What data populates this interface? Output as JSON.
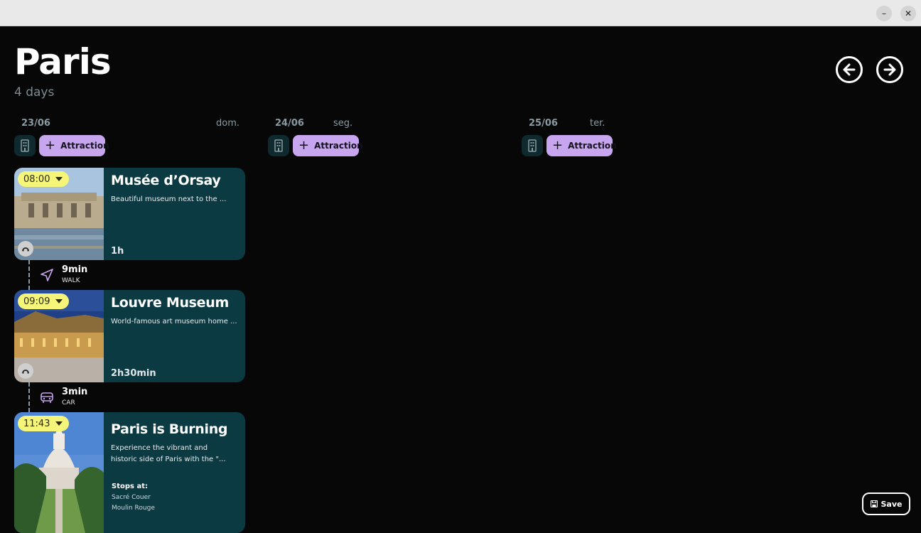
{
  "window": {
    "minimize_icon": "minimize-icon",
    "close_icon": "close-icon",
    "minimize_glyph": "–",
    "close_glyph": "✕"
  },
  "trip": {
    "city": "Paris",
    "duration": "4 days"
  },
  "nav": {
    "prev_icon": "arrow-left-circle-icon",
    "next_icon": "arrow-right-circle-icon"
  },
  "days": [
    {
      "date": "23/06",
      "weekday": "dom.",
      "attraction_label": "Attraction"
    },
    {
      "date": "24/06",
      "weekday": "seg.",
      "attraction_label": "Attraction"
    },
    {
      "date": "25/06",
      "weekday": "ter.",
      "attraction_label": "Attraction"
    }
  ],
  "activities": [
    {
      "time": "08:00",
      "title": "Musée d’Orsay",
      "description": "Beautiful museum next to the ...",
      "duration": "1h"
    },
    {
      "time": "09:09",
      "title": "Louvre Museum",
      "description": "World-famous art museum home ...",
      "duration": "2h30min"
    },
    {
      "time": "11:43",
      "title": "Paris is Burning",
      "description_line1": "Experience the vibrant and",
      "description_line2": "historic side of Paris with the \"...",
      "stops_title": "Stops at:",
      "stops": [
        "Sacré Couer",
        "Moulin Rouge"
      ]
    }
  ],
  "travels": [
    {
      "time": "9min",
      "mode": "WALK",
      "icon": "navigation-arrow-icon"
    },
    {
      "time": "3min",
      "mode": "CAR",
      "icon": "car-icon"
    }
  ],
  "actions": {
    "save_label": "Save"
  },
  "colors": {
    "background": "#070707",
    "card": "#0b3a42",
    "accent": "#c7a6ef",
    "time_pill": "#f5f57a"
  }
}
